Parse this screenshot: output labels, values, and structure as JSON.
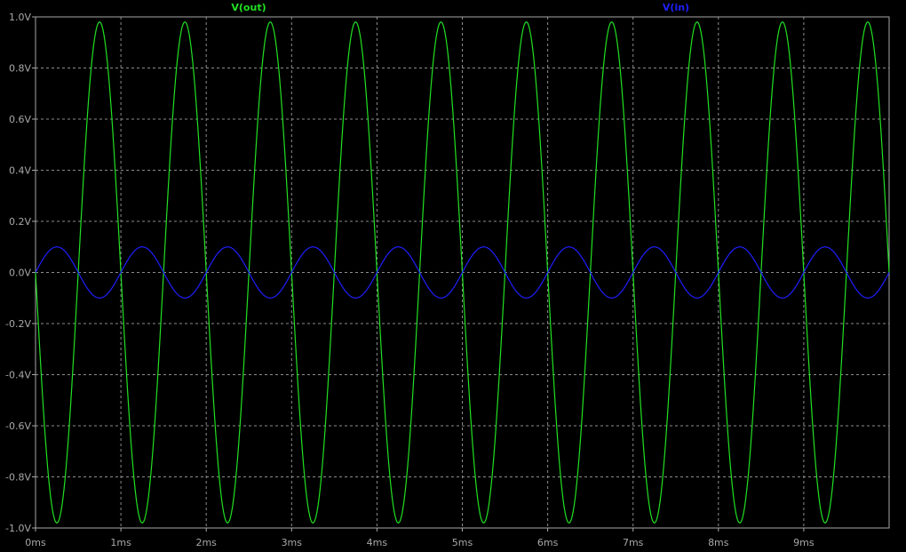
{
  "window": {
    "background": "#000000",
    "grid_color": "#8c8c8c",
    "axis_color": "#a8a8a8"
  },
  "chart_data": {
    "type": "line",
    "title": "",
    "xlabel": "",
    "ylabel": "",
    "xlim": [
      0,
      10
    ],
    "ylim": [
      -1.0,
      1.0
    ],
    "grid": true,
    "x_unit": "ms",
    "y_unit": "V",
    "x_ticks": [
      0,
      1,
      2,
      3,
      4,
      5,
      6,
      7,
      8,
      9
    ],
    "x_tick_labels": [
      "0ms",
      "1ms",
      "2ms",
      "3ms",
      "4ms",
      "5ms",
      "6ms",
      "7ms",
      "8ms",
      "9ms"
    ],
    "y_ticks": [
      1.0,
      0.8,
      0.6,
      0.4,
      0.2,
      0.0,
      -0.2,
      -0.4,
      -0.6,
      -0.8,
      -1.0
    ],
    "y_tick_labels": [
      "1.0V",
      "0.8V",
      "0.6V",
      "0.4V",
      "0.2V",
      "0.0V",
      "-0.2V",
      "-0.4V",
      "-0.6V",
      "-0.8V",
      "-1.0V"
    ],
    "series": [
      {
        "name": "V(out)",
        "color": "#22e022",
        "frequency_khz": 1,
        "amplitude_v": 0.98,
        "phase": "inverted",
        "legend": "top-left"
      },
      {
        "name": "V(in)",
        "color": "#1f1fff",
        "frequency_khz": 1,
        "amplitude_v": 0.1,
        "phase": "normal",
        "legend": "top-right"
      }
    ]
  }
}
